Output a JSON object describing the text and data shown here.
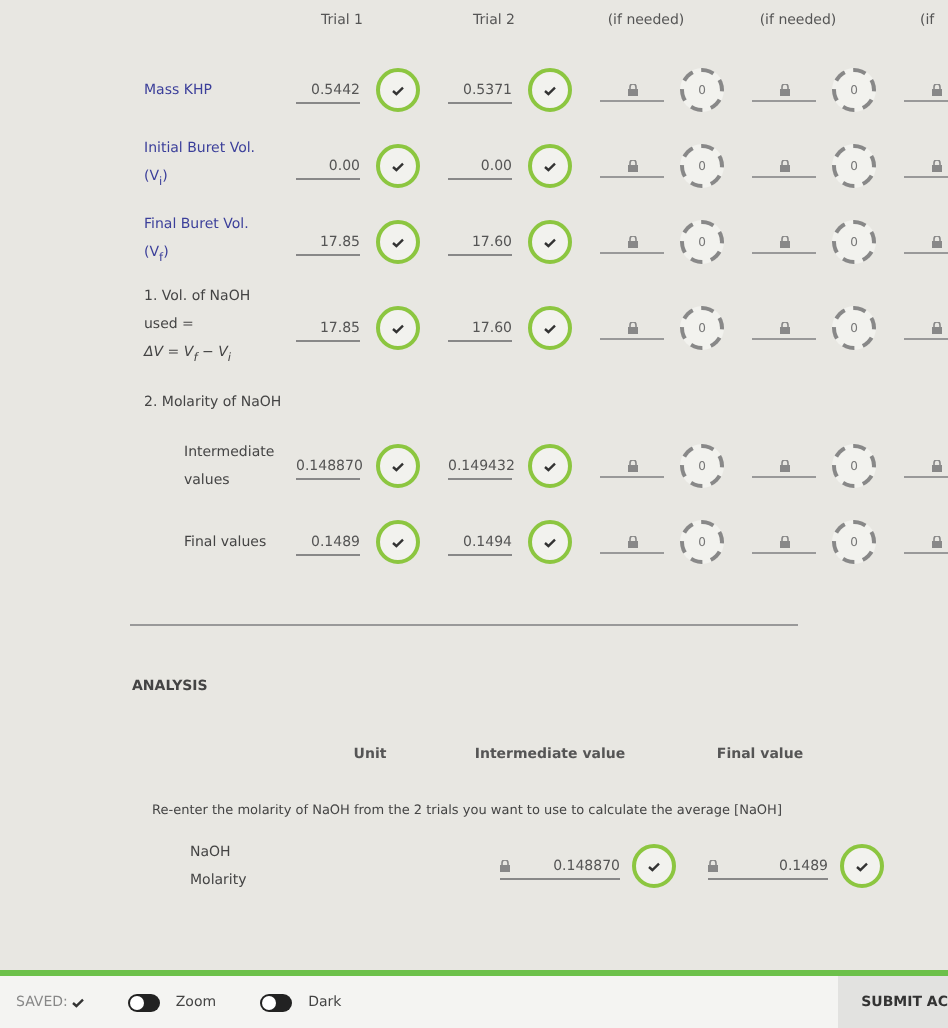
{
  "trials": {
    "headers": [
      "Trial 1",
      "Trial 2",
      "(if needed)",
      "(if needed)",
      "(if"
    ],
    "rows": [
      {
        "kind": "row",
        "label": [
          "Mass KHP"
        ],
        "cells": [
          {
            "locked": false,
            "value": "0.5442"
          },
          {
            "locked": false,
            "value": "0.5371"
          },
          {
            "locked": true,
            "score": "0"
          },
          {
            "locked": true,
            "score": "0"
          },
          {
            "locked": true
          }
        ]
      },
      {
        "kind": "row",
        "label": [
          "Initial Buret Vol.",
          "(V$_{i}$)"
        ],
        "cells": [
          {
            "locked": false,
            "value": "0.00"
          },
          {
            "locked": false,
            "value": "0.00"
          },
          {
            "locked": true,
            "score": "0"
          },
          {
            "locked": true,
            "score": "0"
          },
          {
            "locked": true
          }
        ]
      },
      {
        "kind": "row",
        "label": [
          "Final Buret Vol.",
          "(V$_{f}$)"
        ],
        "cells": [
          {
            "locked": false,
            "value": "17.85"
          },
          {
            "locked": false,
            "value": "17.60"
          },
          {
            "locked": true,
            "score": "0"
          },
          {
            "locked": true,
            "score": "0"
          },
          {
            "locked": true
          }
        ]
      },
      {
        "kind": "step",
        "label": [
          "1. Vol. of NaOH",
          "used =",
          "*ΔV = V$_{f}$ − V$_{i}$*"
        ],
        "cells": [
          {
            "locked": false,
            "value": "17.85"
          },
          {
            "locked": false,
            "value": "17.60"
          },
          {
            "locked": true,
            "score": "0"
          },
          {
            "locked": true,
            "score": "0"
          },
          {
            "locked": true
          }
        ]
      },
      {
        "kind": "heading",
        "label": [
          "2. Molarity of NaOH"
        ]
      },
      {
        "kind": "sub",
        "label": [
          "Intermediate",
          "values"
        ],
        "cells": [
          {
            "locked": false,
            "value": "0.148870"
          },
          {
            "locked": false,
            "value": "0.149432"
          },
          {
            "locked": true,
            "score": "0"
          },
          {
            "locked": true,
            "score": "0"
          },
          {
            "locked": true
          }
        ]
      },
      {
        "kind": "sub",
        "label": [
          "Final values"
        ],
        "cells": [
          {
            "locked": false,
            "value": "0.1489"
          },
          {
            "locked": false,
            "value": "0.1494"
          },
          {
            "locked": true,
            "score": "0"
          },
          {
            "locked": true,
            "score": "0"
          },
          {
            "locked": true
          }
        ]
      }
    ]
  },
  "analysis": {
    "title": "ANALYSIS",
    "headers": [
      "Unit",
      "Intermediate value",
      "Final value"
    ],
    "instruction": "Re-enter the molarity of NaOH from the 2 trials you want to use to calculate the average [NaOH]",
    "rows": [
      {
        "label": [
          "NaOH",
          "Molarity"
        ],
        "cells": [
          {
            "correct": true,
            "value": "0.148870"
          },
          {
            "correct": true,
            "value": "0.1489"
          }
        ]
      }
    ]
  },
  "bottom_bar": {
    "saved": "SAVED:",
    "toggles": [
      {
        "label": "Zoom",
        "on": false
      },
      {
        "label": "Dark",
        "on": false
      }
    ],
    "submit": "SUBMIT AC"
  }
}
